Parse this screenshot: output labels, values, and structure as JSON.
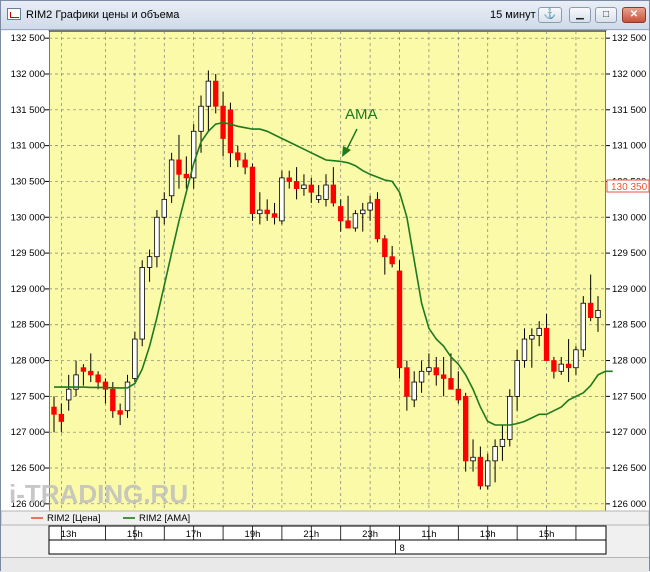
{
  "window": {
    "title": "RIM2 Графики цены и объема",
    "interval": "15 минут",
    "anchor_icon": "anchor-icon",
    "minimize_icon": "minimize-icon",
    "maximize_icon": "maximize-icon",
    "close_icon": "close-icon"
  },
  "watermark": "i-TRADING.RU",
  "legend": [
    {
      "label": "RIM2 [Цена]",
      "color": "#e8553a"
    },
    {
      "label": "RIM2 [AMA]",
      "color": "#1e7a1e"
    }
  ],
  "annotation": "AMA",
  "last_price_label": "130 350",
  "colors": {
    "background": "#fafaa8",
    "up_candle": "#ffffff",
    "down_candle": "#ff0000",
    "ama_line": "#1e7a1e",
    "grid": "#808080"
  },
  "chart_data": {
    "type": "candlestick",
    "ylim": [
      125900,
      132600
    ],
    "y_ticks": [
      126000,
      126500,
      127000,
      127500,
      128000,
      128500,
      129000,
      129500,
      130000,
      130500,
      131000,
      131500,
      132000,
      132500
    ],
    "y_tick_labels": [
      "126 000",
      "126 500",
      "127 000",
      "127 500",
      "128 000",
      "128 500",
      "129 000",
      "129 500",
      "130 000",
      "130 500",
      "131 000",
      "131 500",
      "132 000",
      "132 500"
    ],
    "x_time_labels": [
      "13h",
      "15h",
      "17h",
      "19h",
      "21h",
      "23h",
      "11h",
      "13h",
      "15h"
    ],
    "x_time_label_bar_index": [
      2,
      11,
      19,
      27,
      35,
      43,
      51,
      59,
      67
    ],
    "x_grid_bar_index": [
      1,
      7,
      11,
      15,
      19,
      23,
      27,
      31,
      35,
      39,
      43,
      47,
      51,
      55,
      59,
      63,
      67,
      71
    ],
    "date_label": "8",
    "date_label_bar_index": [
      47
    ],
    "candles": [
      [
        127350,
        127500,
        127000,
        127250
      ],
      [
        127250,
        127400,
        127000,
        127150
      ],
      [
        127450,
        127800,
        127300,
        127600
      ],
      [
        127600,
        128000,
        127500,
        127800
      ],
      [
        127900,
        127950,
        127650,
        127850
      ],
      [
        127850,
        128100,
        127700,
        127800
      ],
      [
        127800,
        127850,
        127600,
        127700
      ],
      [
        127700,
        127750,
        127400,
        127600
      ],
      [
        127600,
        127700,
        127200,
        127300
      ],
      [
        127300,
        127400,
        127100,
        127250
      ],
      [
        127300,
        127800,
        127200,
        127700
      ],
      [
        127750,
        128400,
        127700,
        128300
      ],
      [
        128300,
        129400,
        128200,
        129300
      ],
      [
        129300,
        129550,
        129100,
        129450
      ],
      [
        129450,
        130100,
        129300,
        130000
      ],
      [
        130000,
        130350,
        129900,
        130250
      ],
      [
        130300,
        130900,
        130200,
        130800
      ],
      [
        130800,
        131150,
        130400,
        130600
      ],
      [
        130600,
        130850,
        130400,
        130550
      ],
      [
        130550,
        131300,
        130400,
        131200
      ],
      [
        131200,
        131700,
        130900,
        131550
      ],
      [
        131550,
        132050,
        131200,
        131900
      ],
      [
        131900,
        132000,
        131450,
        131550
      ],
      [
        131550,
        131750,
        130850,
        131100
      ],
      [
        131500,
        131600,
        130700,
        130900
      ],
      [
        130900,
        131000,
        130700,
        130800
      ],
      [
        130800,
        130900,
        130600,
        130700
      ],
      [
        130700,
        130750,
        129950,
        130050
      ],
      [
        130050,
        130350,
        129900,
        130100
      ],
      [
        130100,
        130250,
        129950,
        130050
      ],
      [
        130050,
        130200,
        129900,
        130000
      ],
      [
        129950,
        130650,
        129900,
        130550
      ],
      [
        130550,
        130650,
        130400,
        130500
      ],
      [
        130500,
        130700,
        130250,
        130400
      ],
      [
        130400,
        130600,
        130300,
        130450
      ],
      [
        130450,
        130550,
        130200,
        130350
      ],
      [
        130250,
        130450,
        130200,
        130300
      ],
      [
        130250,
        130600,
        130150,
        130450
      ],
      [
        130450,
        130700,
        130150,
        130200
      ],
      [
        130150,
        130250,
        129800,
        129950
      ],
      [
        129950,
        130300,
        129850,
        129850
      ],
      [
        129850,
        130100,
        129800,
        130050
      ],
      [
        130050,
        130200,
        129800,
        130100
      ],
      [
        130100,
        130300,
        129950,
        130200
      ],
      [
        130250,
        130350,
        129650,
        129700
      ],
      [
        129700,
        129750,
        129200,
        129450
      ],
      [
        129450,
        129600,
        129300,
        129350
      ],
      [
        129250,
        129400,
        127750,
        127900
      ],
      [
        127900,
        128000,
        127300,
        127500
      ],
      [
        127450,
        127850,
        127350,
        127700
      ],
      [
        127700,
        128000,
        127550,
        127850
      ],
      [
        127850,
        128100,
        127800,
        127900
      ],
      [
        127900,
        128050,
        127650,
        127800
      ],
      [
        127800,
        128050,
        127500,
        127750
      ],
      [
        127750,
        128100,
        127600,
        127600
      ],
      [
        127600,
        127850,
        127400,
        127450
      ],
      [
        127500,
        127550,
        126450,
        126600
      ],
      [
        126600,
        126900,
        126450,
        126650
      ],
      [
        126650,
        126800,
        126200,
        126250
      ],
      [
        126250,
        126700,
        126200,
        126600
      ],
      [
        126600,
        126900,
        126300,
        126800
      ],
      [
        126800,
        127100,
        126600,
        126900
      ],
      [
        126900,
        127600,
        126800,
        127500
      ],
      [
        127500,
        128150,
        127300,
        128000
      ],
      [
        128000,
        128450,
        127900,
        128300
      ],
      [
        128300,
        128450,
        127900,
        128350
      ],
      [
        128350,
        128550,
        128200,
        128450
      ],
      [
        128450,
        128650,
        128050,
        128000
      ],
      [
        128000,
        128050,
        127750,
        127850
      ],
      [
        127850,
        128050,
        127800,
        127950
      ],
      [
        127950,
        128300,
        127700,
        127900
      ],
      [
        127900,
        128200,
        127800,
        128150
      ],
      [
        128150,
        128900,
        128050,
        128800
      ],
      [
        128800,
        129200,
        128550,
        128600
      ],
      [
        128600,
        128900,
        128400,
        128700
      ]
    ],
    "ama": [
      127630,
      127630,
      127630,
      127630,
      127630,
      127625,
      127625,
      127622,
      127620,
      127618,
      127620,
      127680,
      127880,
      128200,
      128600,
      129050,
      129500,
      129950,
      130350,
      130750,
      131050,
      131200,
      131300,
      131320,
      131300,
      131270,
      131250,
      131230,
      131230,
      131200,
      131150,
      131100,
      131050,
      131000,
      130950,
      130900,
      130850,
      130800,
      130790,
      130780,
      130760,
      130720,
      130650,
      130600,
      130560,
      130520,
      130500,
      130350,
      130000,
      129400,
      128800,
      128450,
      128300,
      128200,
      128050,
      127950,
      127800,
      127600,
      127350,
      127150,
      127100,
      127100,
      127100,
      127120,
      127150,
      127200,
      127250,
      127250,
      127300,
      127350,
      127450,
      127500,
      127550,
      127650,
      127800,
      127850,
      127850
    ]
  }
}
